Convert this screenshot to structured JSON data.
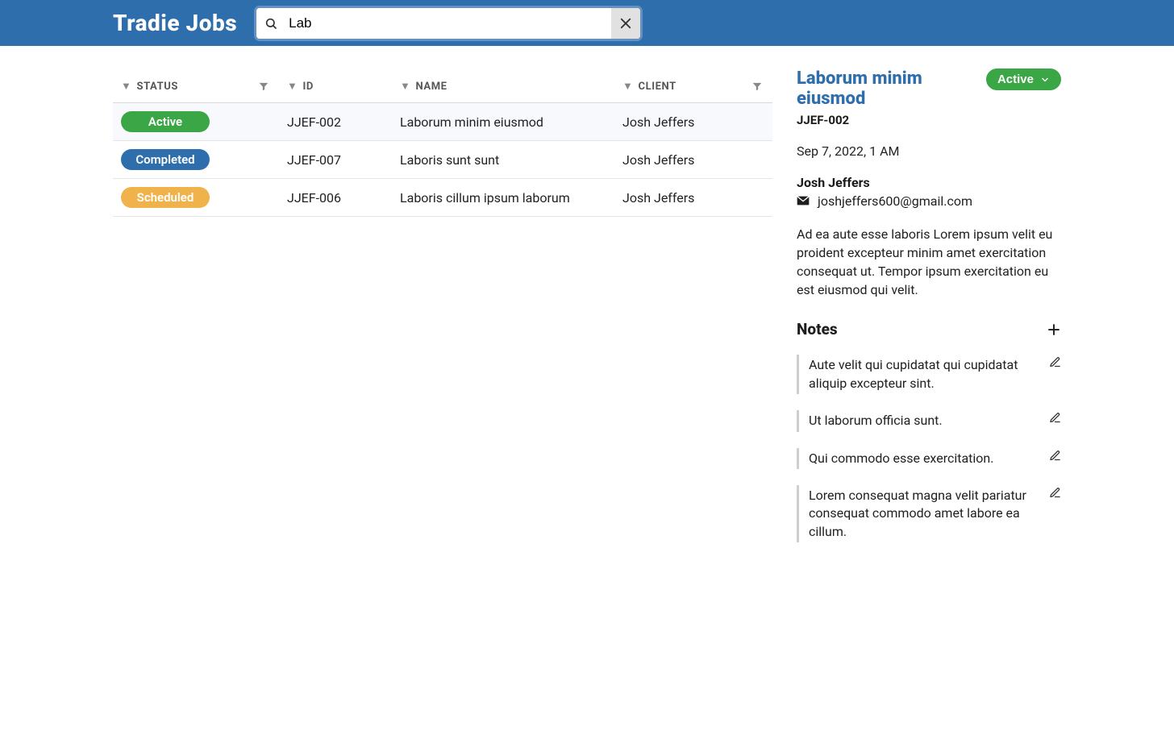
{
  "header": {
    "app_title": "Tradie Jobs",
    "search_value": "Lab"
  },
  "table": {
    "columns": {
      "status": "STATUS",
      "id": "ID",
      "name": "NAME",
      "client": "CLIENT"
    },
    "rows": [
      {
        "status": "Active",
        "status_class": "status-active",
        "id": "JJEF-002",
        "name": "Laborum minim eiusmod",
        "client": "Josh Jeffers",
        "selected": true
      },
      {
        "status": "Completed",
        "status_class": "status-completed",
        "id": "JJEF-007",
        "name": "Laboris sunt sunt",
        "client": "Josh Jeffers",
        "selected": false
      },
      {
        "status": "Scheduled",
        "status_class": "status-scheduled",
        "id": "JJEF-006",
        "name": "Laboris cillum ipsum laborum",
        "client": "Josh Jeffers",
        "selected": false
      }
    ]
  },
  "detail": {
    "title": "Laborum minim eiusmod",
    "id": "JJEF-002",
    "status_label": "Active",
    "date": "Sep 7, 2022, 1 AM",
    "client_name": "Josh Jeffers",
    "client_email": "joshjeffers600@gmail.com",
    "description": "Ad ea aute esse laboris Lorem ipsum velit eu proident excepteur minim amet exercitation consequat ut. Tempor ipsum exercitation eu est eiusmod qui velit.",
    "notes_heading": "Notes",
    "notes": [
      "Aute velit qui cupidatat qui cupidatat aliquip excepteur sint.",
      "Ut laborum officia sunt.",
      "Qui commodo esse exercitation.",
      "Lorem consequat magna velit pariatur consequat commodo amet labore ea cillum."
    ]
  },
  "colors": {
    "brand": "#2f6eac",
    "active": "#3aa645",
    "completed": "#2e6eac",
    "scheduled": "#f0b24b"
  }
}
